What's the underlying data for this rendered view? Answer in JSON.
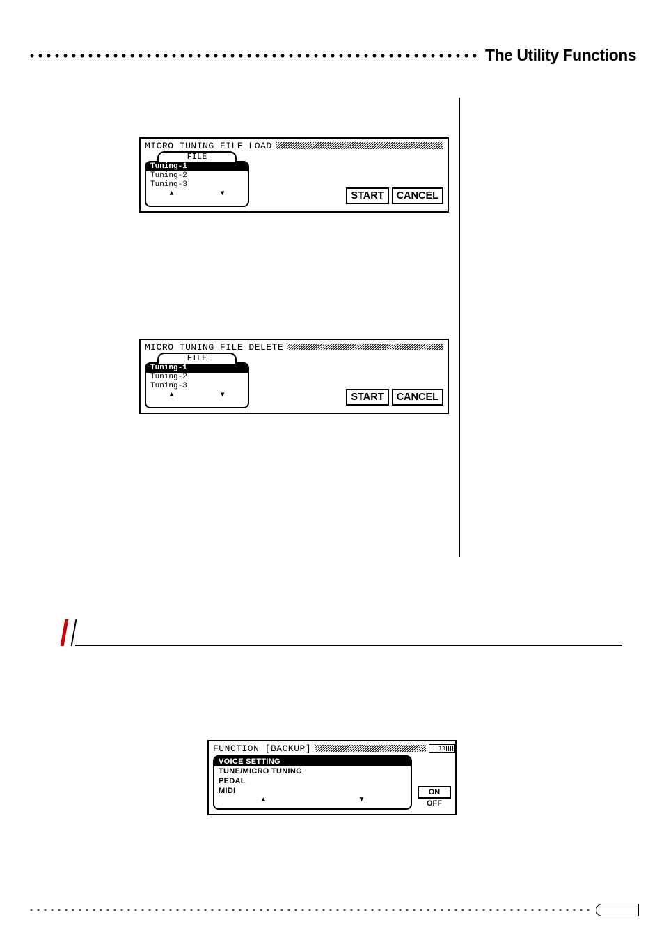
{
  "header": {
    "title": "The Utility Functions"
  },
  "lcd_load": {
    "title": "MICRO TUNING FILE LOAD",
    "file_label": "FILE",
    "items": [
      "Tuning-1",
      "Tuning-2",
      "Tuning-3"
    ],
    "selected_index": 0,
    "up": "▲",
    "down": "▼",
    "start": "START",
    "cancel": "CANCEL"
  },
  "lcd_delete": {
    "title": "MICRO TUNING FILE DELETE",
    "file_label": "FILE",
    "items": [
      "Tuning-1",
      "Tuning-2",
      "Tuning-3"
    ],
    "selected_index": 0,
    "up": "▲",
    "down": "▼",
    "start": "START",
    "cancel": "CANCEL"
  },
  "lcd_backup": {
    "title": "FUNCTION [BACKUP]",
    "items": [
      "VOICE SETTING",
      "TUNE/MICRO TUNING",
      "PEDAL",
      "MIDI"
    ],
    "selected_index": 0,
    "up": "▲",
    "down": "▼",
    "on": "ON",
    "off": "OFF",
    "page": "13"
  }
}
